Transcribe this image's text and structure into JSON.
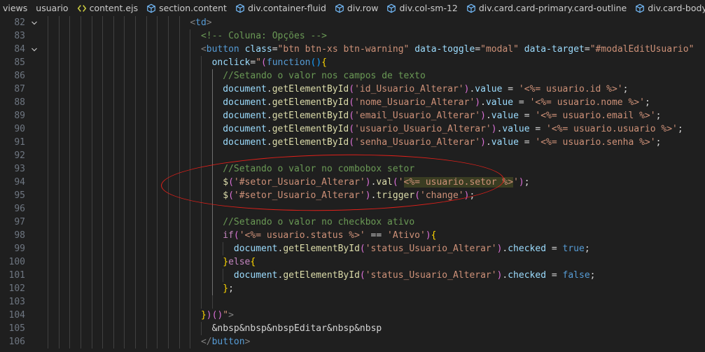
{
  "breadcrumb": [
    {
      "label": "views",
      "icon": "none"
    },
    {
      "label": "usuario",
      "icon": "none"
    },
    {
      "label": "content.ejs",
      "icon": "ejs-file-icon"
    },
    {
      "label": "section.content",
      "icon": "element-cube-icon"
    },
    {
      "label": "div.container-fluid",
      "icon": "element-cube-icon"
    },
    {
      "label": "div.row",
      "icon": "element-cube-icon"
    },
    {
      "label": "div.col-sm-12",
      "icon": "element-cube-icon"
    },
    {
      "label": "div.card.card-primary.card-outline",
      "icon": "element-cube-icon"
    },
    {
      "label": "div.card-body",
      "icon": "element-cube-icon"
    }
  ],
  "colors": {
    "background": "#1f1f1f",
    "annotation": "#e0201a",
    "line_number": "#6e7681"
  },
  "lines": [
    {
      "n": "82",
      "indent": 13,
      "fold": true,
      "tokens": [
        [
          "tag-punct",
          "<"
        ],
        [
          "tag",
          "td"
        ],
        [
          "tag-punct",
          ">"
        ]
      ]
    },
    {
      "n": "83",
      "indent": 14,
      "fold": false,
      "tokens": [
        [
          "com",
          "<!-- Coluna: Opções -->"
        ]
      ]
    },
    {
      "n": "84",
      "indent": 14,
      "fold": true,
      "tokens": [
        [
          "tag-punct",
          "<"
        ],
        [
          "tag",
          "button"
        ],
        [
          "plain",
          " "
        ],
        [
          "attr",
          "class"
        ],
        [
          "plain",
          "="
        ],
        [
          "str",
          "\"btn btn-xs btn-warning\""
        ],
        [
          "plain",
          " "
        ],
        [
          "attr",
          "data-toggle"
        ],
        [
          "plain",
          "="
        ],
        [
          "str",
          "\"modal\""
        ],
        [
          "plain",
          " "
        ],
        [
          "attr",
          "data-target"
        ],
        [
          "plain",
          "="
        ],
        [
          "str",
          "\"#modalEditUsuario\""
        ]
      ]
    },
    {
      "n": "85",
      "indent": 15,
      "fold": false,
      "tokens": [
        [
          "attr",
          "onclick"
        ],
        [
          "plain",
          "="
        ],
        [
          "str",
          "\""
        ],
        [
          "paren",
          "("
        ],
        [
          "kw",
          "function"
        ],
        [
          "paren2",
          "("
        ],
        [
          "paren2",
          ")"
        ],
        [
          "brace",
          "{"
        ]
      ]
    },
    {
      "n": "86",
      "indent": 16,
      "fold": false,
      "tokens": [
        [
          "com",
          "//Setando o valor nos campos de texto"
        ]
      ]
    },
    {
      "n": "87",
      "indent": 16,
      "fold": false,
      "tokens": [
        [
          "var",
          "document"
        ],
        [
          "plain",
          "."
        ],
        [
          "fn",
          "getElementById"
        ],
        [
          "paren",
          "("
        ],
        [
          "str",
          "'id_Usuario_Alterar'"
        ],
        [
          "paren",
          ")"
        ],
        [
          "plain",
          "."
        ],
        [
          "var",
          "value"
        ],
        [
          "plain",
          " = "
        ],
        [
          "str",
          "'<%= usuario.id %>'"
        ],
        [
          "plain",
          ";"
        ]
      ]
    },
    {
      "n": "88",
      "indent": 16,
      "fold": false,
      "tokens": [
        [
          "var",
          "document"
        ],
        [
          "plain",
          "."
        ],
        [
          "fn",
          "getElementById"
        ],
        [
          "paren",
          "("
        ],
        [
          "str",
          "'nome_Usuario_Alterar'"
        ],
        [
          "paren",
          ")"
        ],
        [
          "plain",
          "."
        ],
        [
          "var",
          "value"
        ],
        [
          "plain",
          " = "
        ],
        [
          "str",
          "'<%= usuario.nome %>'"
        ],
        [
          "plain",
          ";"
        ]
      ]
    },
    {
      "n": "89",
      "indent": 16,
      "fold": false,
      "tokens": [
        [
          "var",
          "document"
        ],
        [
          "plain",
          "."
        ],
        [
          "fn",
          "getElementById"
        ],
        [
          "paren",
          "("
        ],
        [
          "str",
          "'email_Usuario_Alterar'"
        ],
        [
          "paren",
          ")"
        ],
        [
          "plain",
          "."
        ],
        [
          "var",
          "value"
        ],
        [
          "plain",
          " = "
        ],
        [
          "str",
          "'<%= usuario.email %>'"
        ],
        [
          "plain",
          ";"
        ]
      ]
    },
    {
      "n": "90",
      "indent": 16,
      "fold": false,
      "tokens": [
        [
          "var",
          "document"
        ],
        [
          "plain",
          "."
        ],
        [
          "fn",
          "getElementById"
        ],
        [
          "paren",
          "("
        ],
        [
          "str",
          "'usuario_Usuario_Alterar'"
        ],
        [
          "paren",
          ")"
        ],
        [
          "plain",
          "."
        ],
        [
          "var",
          "value"
        ],
        [
          "plain",
          " = "
        ],
        [
          "str",
          "'<%= usuario.usuario %>'"
        ],
        [
          "plain",
          ";"
        ]
      ]
    },
    {
      "n": "91",
      "indent": 16,
      "fold": false,
      "tokens": [
        [
          "var",
          "document"
        ],
        [
          "plain",
          "."
        ],
        [
          "fn",
          "getElementById"
        ],
        [
          "paren",
          "("
        ],
        [
          "str",
          "'senha_Usuario_Alterar'"
        ],
        [
          "paren",
          ")"
        ],
        [
          "plain",
          "."
        ],
        [
          "var",
          "value"
        ],
        [
          "plain",
          " = "
        ],
        [
          "str",
          "'<%= usuario.senha %>'"
        ],
        [
          "plain",
          ";"
        ]
      ]
    },
    {
      "n": "92",
      "indent": 16,
      "fold": false,
      "tokens": []
    },
    {
      "n": "93",
      "indent": 16,
      "fold": false,
      "tokens": [
        [
          "com",
          "//Setando o valor no combobox setor"
        ]
      ]
    },
    {
      "n": "94",
      "indent": 16,
      "fold": false,
      "tokens": [
        [
          "fn",
          "$"
        ],
        [
          "paren",
          "("
        ],
        [
          "str",
          "'#setor_Usuario_Alterar'"
        ],
        [
          "paren",
          ")"
        ],
        [
          "plain",
          "."
        ],
        [
          "fn",
          "val"
        ],
        [
          "paren",
          "("
        ],
        [
          "str",
          "'"
        ],
        [
          "str-hl",
          "<%= usuario.setor %>"
        ],
        [
          "str",
          "'"
        ],
        [
          "paren",
          ")"
        ],
        [
          "plain",
          ";"
        ]
      ]
    },
    {
      "n": "95",
      "indent": 16,
      "fold": false,
      "tokens": [
        [
          "fn",
          "$"
        ],
        [
          "paren",
          "("
        ],
        [
          "str",
          "'#setor_Usuario_Alterar'"
        ],
        [
          "paren",
          ")"
        ],
        [
          "plain",
          "."
        ],
        [
          "fn",
          "trigger"
        ],
        [
          "paren",
          "("
        ],
        [
          "str",
          "'change'"
        ],
        [
          "paren",
          ")"
        ],
        [
          "plain",
          ";"
        ]
      ]
    },
    {
      "n": "96",
      "indent": 16,
      "fold": false,
      "tokens": []
    },
    {
      "n": "97",
      "indent": 16,
      "fold": false,
      "tokens": [
        [
          "com",
          "//Setando o valor no checkbox ativo"
        ]
      ]
    },
    {
      "n": "98",
      "indent": 16,
      "fold": false,
      "tokens": [
        [
          "kwc",
          "if"
        ],
        [
          "paren",
          "("
        ],
        [
          "str",
          "'<%= usuario.status %>'"
        ],
        [
          "plain",
          " == "
        ],
        [
          "str",
          "'Ativo'"
        ],
        [
          "paren",
          ")"
        ],
        [
          "brace",
          "{"
        ]
      ]
    },
    {
      "n": "99",
      "indent": 17,
      "fold": false,
      "tokens": [
        [
          "var",
          "document"
        ],
        [
          "plain",
          "."
        ],
        [
          "fn",
          "getElementById"
        ],
        [
          "paren",
          "("
        ],
        [
          "str",
          "'status_Usuario_Alterar'"
        ],
        [
          "paren",
          ")"
        ],
        [
          "plain",
          "."
        ],
        [
          "var",
          "checked"
        ],
        [
          "plain",
          " = "
        ],
        [
          "kw",
          "true"
        ],
        [
          "plain",
          ";"
        ]
      ]
    },
    {
      "n": "100",
      "indent": 16,
      "fold": false,
      "tokens": [
        [
          "brace",
          "}"
        ],
        [
          "kwc",
          "else"
        ],
        [
          "brace",
          "{"
        ]
      ]
    },
    {
      "n": "101",
      "indent": 17,
      "fold": false,
      "tokens": [
        [
          "var",
          "document"
        ],
        [
          "plain",
          "."
        ],
        [
          "fn",
          "getElementById"
        ],
        [
          "paren",
          "("
        ],
        [
          "str",
          "'status_Usuario_Alterar'"
        ],
        [
          "paren",
          ")"
        ],
        [
          "plain",
          "."
        ],
        [
          "var",
          "checked"
        ],
        [
          "plain",
          " = "
        ],
        [
          "kw",
          "false"
        ],
        [
          "plain",
          ";"
        ]
      ]
    },
    {
      "n": "102",
      "indent": 16,
      "fold": false,
      "tokens": [
        [
          "brace",
          "}"
        ],
        [
          "plain",
          ";"
        ]
      ]
    },
    {
      "n": "103",
      "indent": 16,
      "fold": false,
      "tokens": []
    },
    {
      "n": "104",
      "indent": 14,
      "fold": false,
      "tokens": [
        [
          "brace",
          "}"
        ],
        [
          "paren",
          ")"
        ],
        [
          "paren",
          "("
        ],
        [
          "paren",
          ")"
        ],
        [
          "str",
          "\""
        ],
        [
          "tag-punct",
          ">"
        ]
      ]
    },
    {
      "n": "105",
      "indent": 15,
      "fold": false,
      "tokens": [
        [
          "plain",
          "&nbsp&nbsp&nbspEditar&nbsp&nbsp"
        ]
      ]
    },
    {
      "n": "106",
      "indent": 14,
      "fold": false,
      "tokens": [
        [
          "tag-punct",
          "</"
        ],
        [
          "tag",
          "button"
        ],
        [
          "tag-punct",
          ">"
        ]
      ]
    }
  ]
}
